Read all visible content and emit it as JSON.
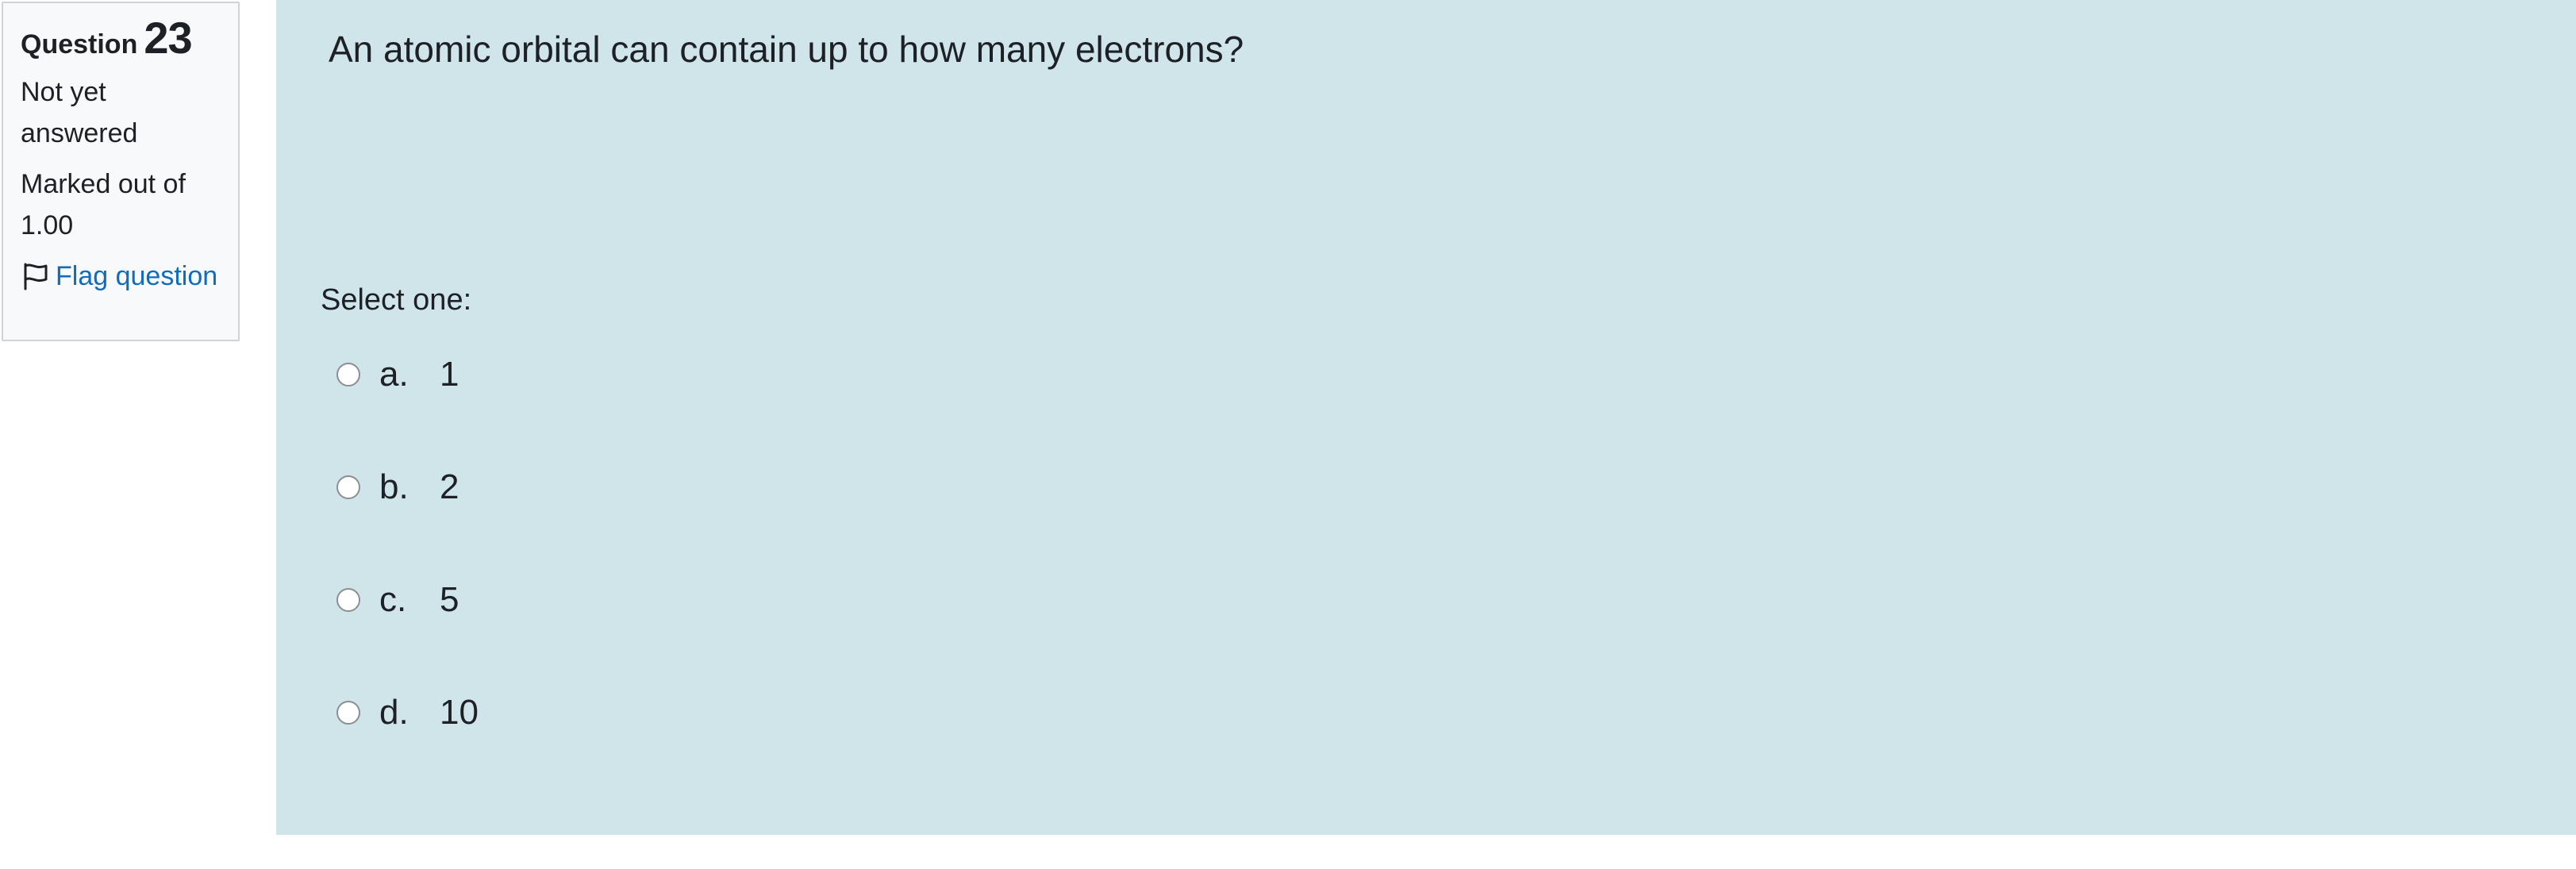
{
  "info": {
    "question_label": "Question",
    "question_number": "23",
    "status": "Not yet answered",
    "marked": "Marked out of 1.00",
    "flag_label": "Flag question",
    "flag_icon": "flag-outline-icon"
  },
  "question": {
    "text": "An atomic orbital can contain up to how many electrons?",
    "prompt": "Select one:",
    "answers": [
      {
        "letter": "a.",
        "value": "1",
        "selected": false
      },
      {
        "letter": "b.",
        "value": "2",
        "selected": false
      },
      {
        "letter": "c.",
        "value": "5",
        "selected": false
      },
      {
        "letter": "d.",
        "value": "10",
        "selected": false
      }
    ]
  },
  "colors": {
    "content_bg": "#cfe5ea",
    "info_bg": "#f8f9fa",
    "link": "#0f6cbf",
    "text": "#1d2125"
  }
}
